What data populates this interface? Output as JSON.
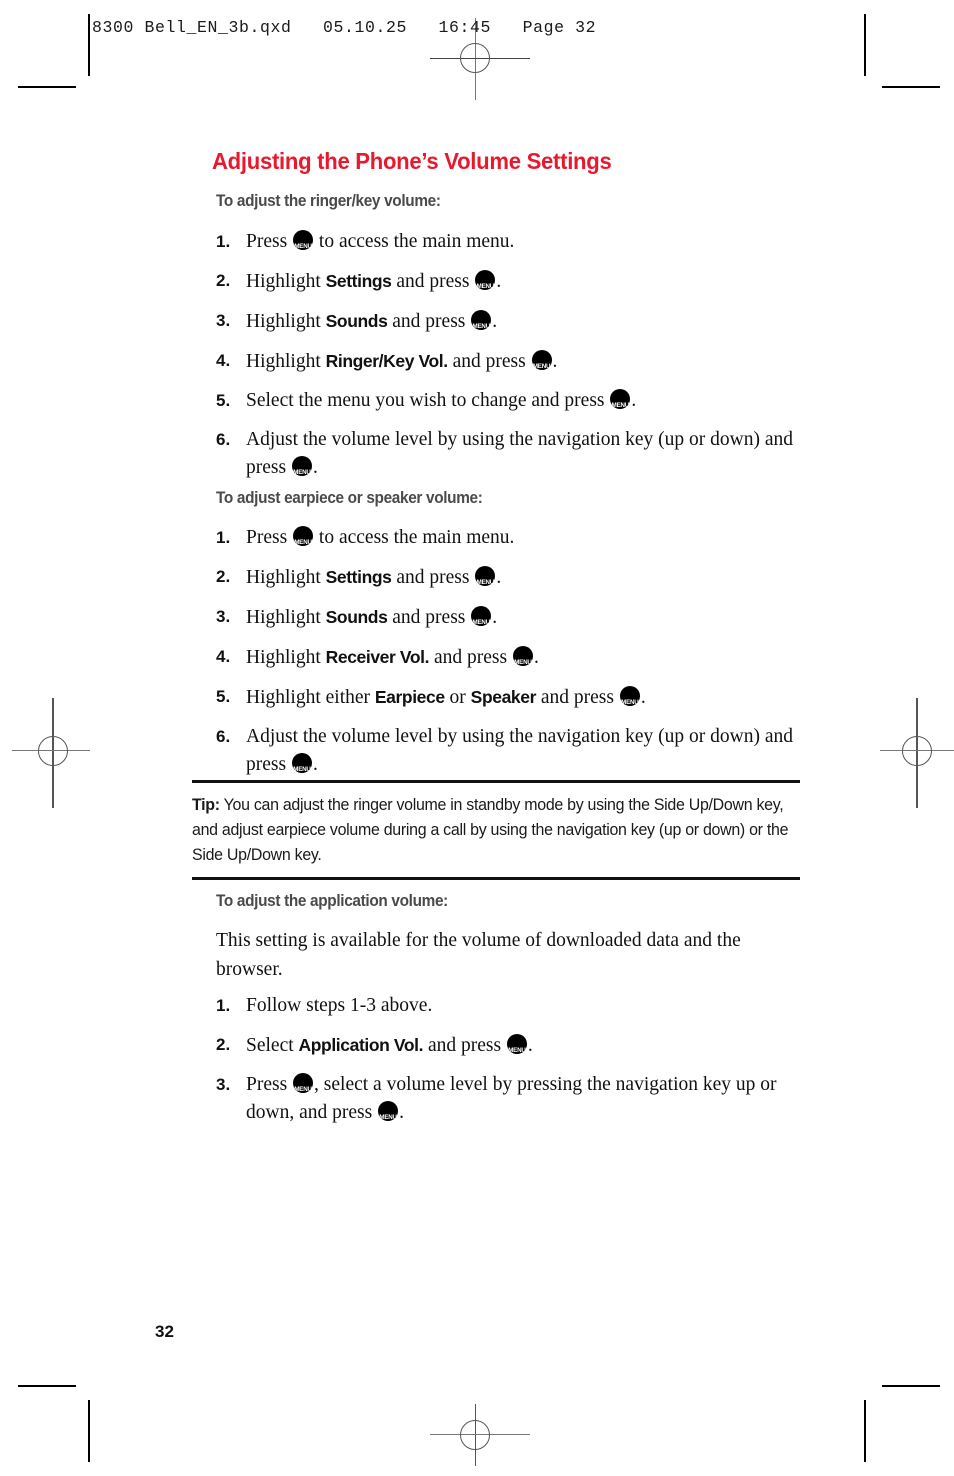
{
  "prepress": {
    "header_line": "8300 Bell_EN_3b.qxd   05.10.25   16:45   Page 32"
  },
  "page": {
    "title": "Adjusting the Phone’s Volume Settings",
    "folio": "32",
    "menu_key": {
      "top": "MENU",
      "bottom": "OK",
      "name": "menu-ok-key"
    }
  },
  "sections": [
    {
      "heading": "To adjust the ringer/key volume:",
      "steps": [
        {
          "num": "1.",
          "parts": [
            {
              "t": "text",
              "v": "Press "
            },
            {
              "t": "key"
            },
            {
              "t": "text",
              "v": " to access the main menu."
            }
          ]
        },
        {
          "num": "2.",
          "parts": [
            {
              "t": "text",
              "v": "Highlight "
            },
            {
              "t": "bold",
              "v": "Settings"
            },
            {
              "t": "text",
              "v": " and press "
            },
            {
              "t": "key"
            },
            {
              "t": "text",
              "v": "."
            }
          ]
        },
        {
          "num": "3.",
          "parts": [
            {
              "t": "text",
              "v": "Highlight "
            },
            {
              "t": "bold",
              "v": "Sounds"
            },
            {
              "t": "text",
              "v": " and press "
            },
            {
              "t": "key"
            },
            {
              "t": "text",
              "v": "."
            }
          ]
        },
        {
          "num": "4.",
          "parts": [
            {
              "t": "text",
              "v": "Highlight "
            },
            {
              "t": "bold",
              "v": "Ringer/Key Vol."
            },
            {
              "t": "text",
              "v": " and press "
            },
            {
              "t": "key"
            },
            {
              "t": "text",
              "v": "."
            }
          ]
        },
        {
          "num": "5.",
          "parts": [
            {
              "t": "text",
              "v": "Select the menu you wish to change and press "
            },
            {
              "t": "key"
            },
            {
              "t": "text",
              "v": "."
            }
          ]
        },
        {
          "num": "6.",
          "parts": [
            {
              "t": "text",
              "v": "Adjust the volume level by using the navigation key (up or down) and press "
            },
            {
              "t": "key"
            },
            {
              "t": "text",
              "v": "."
            }
          ]
        }
      ]
    },
    {
      "heading": "To adjust earpiece or speaker volume:",
      "steps": [
        {
          "num": "1.",
          "parts": [
            {
              "t": "text",
              "v": "Press "
            },
            {
              "t": "key"
            },
            {
              "t": "text",
              "v": " to access the main menu."
            }
          ]
        },
        {
          "num": "2.",
          "parts": [
            {
              "t": "text",
              "v": "Highlight "
            },
            {
              "t": "bold",
              "v": "Settings"
            },
            {
              "t": "text",
              "v": " and press "
            },
            {
              "t": "key"
            },
            {
              "t": "text",
              "v": "."
            }
          ]
        },
        {
          "num": "3.",
          "parts": [
            {
              "t": "text",
              "v": "Highlight "
            },
            {
              "t": "bold",
              "v": "Sounds"
            },
            {
              "t": "text",
              "v": " and press "
            },
            {
              "t": "key"
            },
            {
              "t": "text",
              "v": "."
            }
          ]
        },
        {
          "num": "4.",
          "parts": [
            {
              "t": "text",
              "v": "Highlight "
            },
            {
              "t": "bold",
              "v": "Receiver Vol."
            },
            {
              "t": "text",
              "v": " and press "
            },
            {
              "t": "key"
            },
            {
              "t": "text",
              "v": "."
            }
          ]
        },
        {
          "num": "5.",
          "parts": [
            {
              "t": "text",
              "v": "Highlight either "
            },
            {
              "t": "bold",
              "v": "Earpiece"
            },
            {
              "t": "text",
              "v": " or "
            },
            {
              "t": "bold",
              "v": "Speaker"
            },
            {
              "t": "text",
              "v": " and press "
            },
            {
              "t": "key"
            },
            {
              "t": "text",
              "v": "."
            }
          ]
        },
        {
          "num": "6.",
          "parts": [
            {
              "t": "text",
              "v": "Adjust the volume level by using the navigation key (up or down) and press "
            },
            {
              "t": "key"
            },
            {
              "t": "text",
              "v": "."
            }
          ]
        }
      ]
    },
    {
      "heading": "To adjust the application volume:",
      "intro": "This setting is available for the volume of downloaded data and the browser.",
      "steps": [
        {
          "num": "1.",
          "parts": [
            {
              "t": "text",
              "v": "Follow steps 1-3 above."
            }
          ]
        },
        {
          "num": "2.",
          "parts": [
            {
              "t": "text",
              "v": "Select "
            },
            {
              "t": "bold",
              "v": "Application Vol."
            },
            {
              "t": "text",
              "v": " and press "
            },
            {
              "t": "key"
            },
            {
              "t": "text",
              "v": "."
            }
          ]
        },
        {
          "num": "3.",
          "parts": [
            {
              "t": "text",
              "v": "Press "
            },
            {
              "t": "key"
            },
            {
              "t": "text",
              "v": ", select a volume level by pressing the navigation key up or down, and press "
            },
            {
              "t": "key"
            },
            {
              "t": "text",
              "v": "."
            }
          ]
        }
      ]
    }
  ],
  "tip": {
    "label": "Tip:",
    "text": " You can adjust the ringer volume in standby mode by using the Side Up/Down key, and adjust earpiece volume during a call by using the navigation key (up or down) or the Side Up/Down key."
  },
  "colors": {
    "title_red": "#e8192c",
    "subheading_gray": "#4a4a4a",
    "body_black": "#111111"
  }
}
